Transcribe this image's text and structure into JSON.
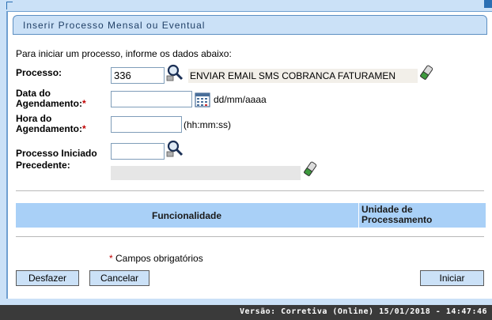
{
  "panel": {
    "title": "Inserir Processo Mensal ou Eventual"
  },
  "intro": "Para iniciar um processo, informe os dados abaixo:",
  "form": {
    "processo": {
      "label": "Processo:",
      "value": "336",
      "description": "ENVIAR EMAIL SMS COBRANCA FATURAMEN"
    },
    "data_agendamento": {
      "label_line1": "Data do",
      "label_line2": "Agendamento:",
      "required_mark": "*",
      "value": "",
      "format_hint": "dd/mm/aaaa"
    },
    "hora_agendamento": {
      "label_line1": "Hora do",
      "label_line2": "Agendamento:",
      "required_mark": "*",
      "value": "",
      "format_hint": "(hh:mm:ss)"
    },
    "processo_precedente": {
      "label_line1": "Processo Iniciado",
      "label_line2": "Precedente:",
      "value": "",
      "description": ""
    }
  },
  "table": {
    "columns": [
      "Funcionalidade",
      "Unidade de Processamento"
    ],
    "col2_line1": "Unidade de",
    "col2_line2": "Processamento"
  },
  "required_note": {
    "mark": "*",
    "text": "Campos obrigatórios"
  },
  "buttons": {
    "undo": "Desfazer",
    "cancel": "Cancelar",
    "start": "Iniciar"
  },
  "footer": {
    "version": "Versão: Corretiva (Online) 15/01/2018 - 14:47:46"
  },
  "colors": {
    "header_bg": "#cbe1f7",
    "table_header_bg": "#a9d0f7",
    "required": "#c00000",
    "footer_bg": "#3a3a3a"
  }
}
